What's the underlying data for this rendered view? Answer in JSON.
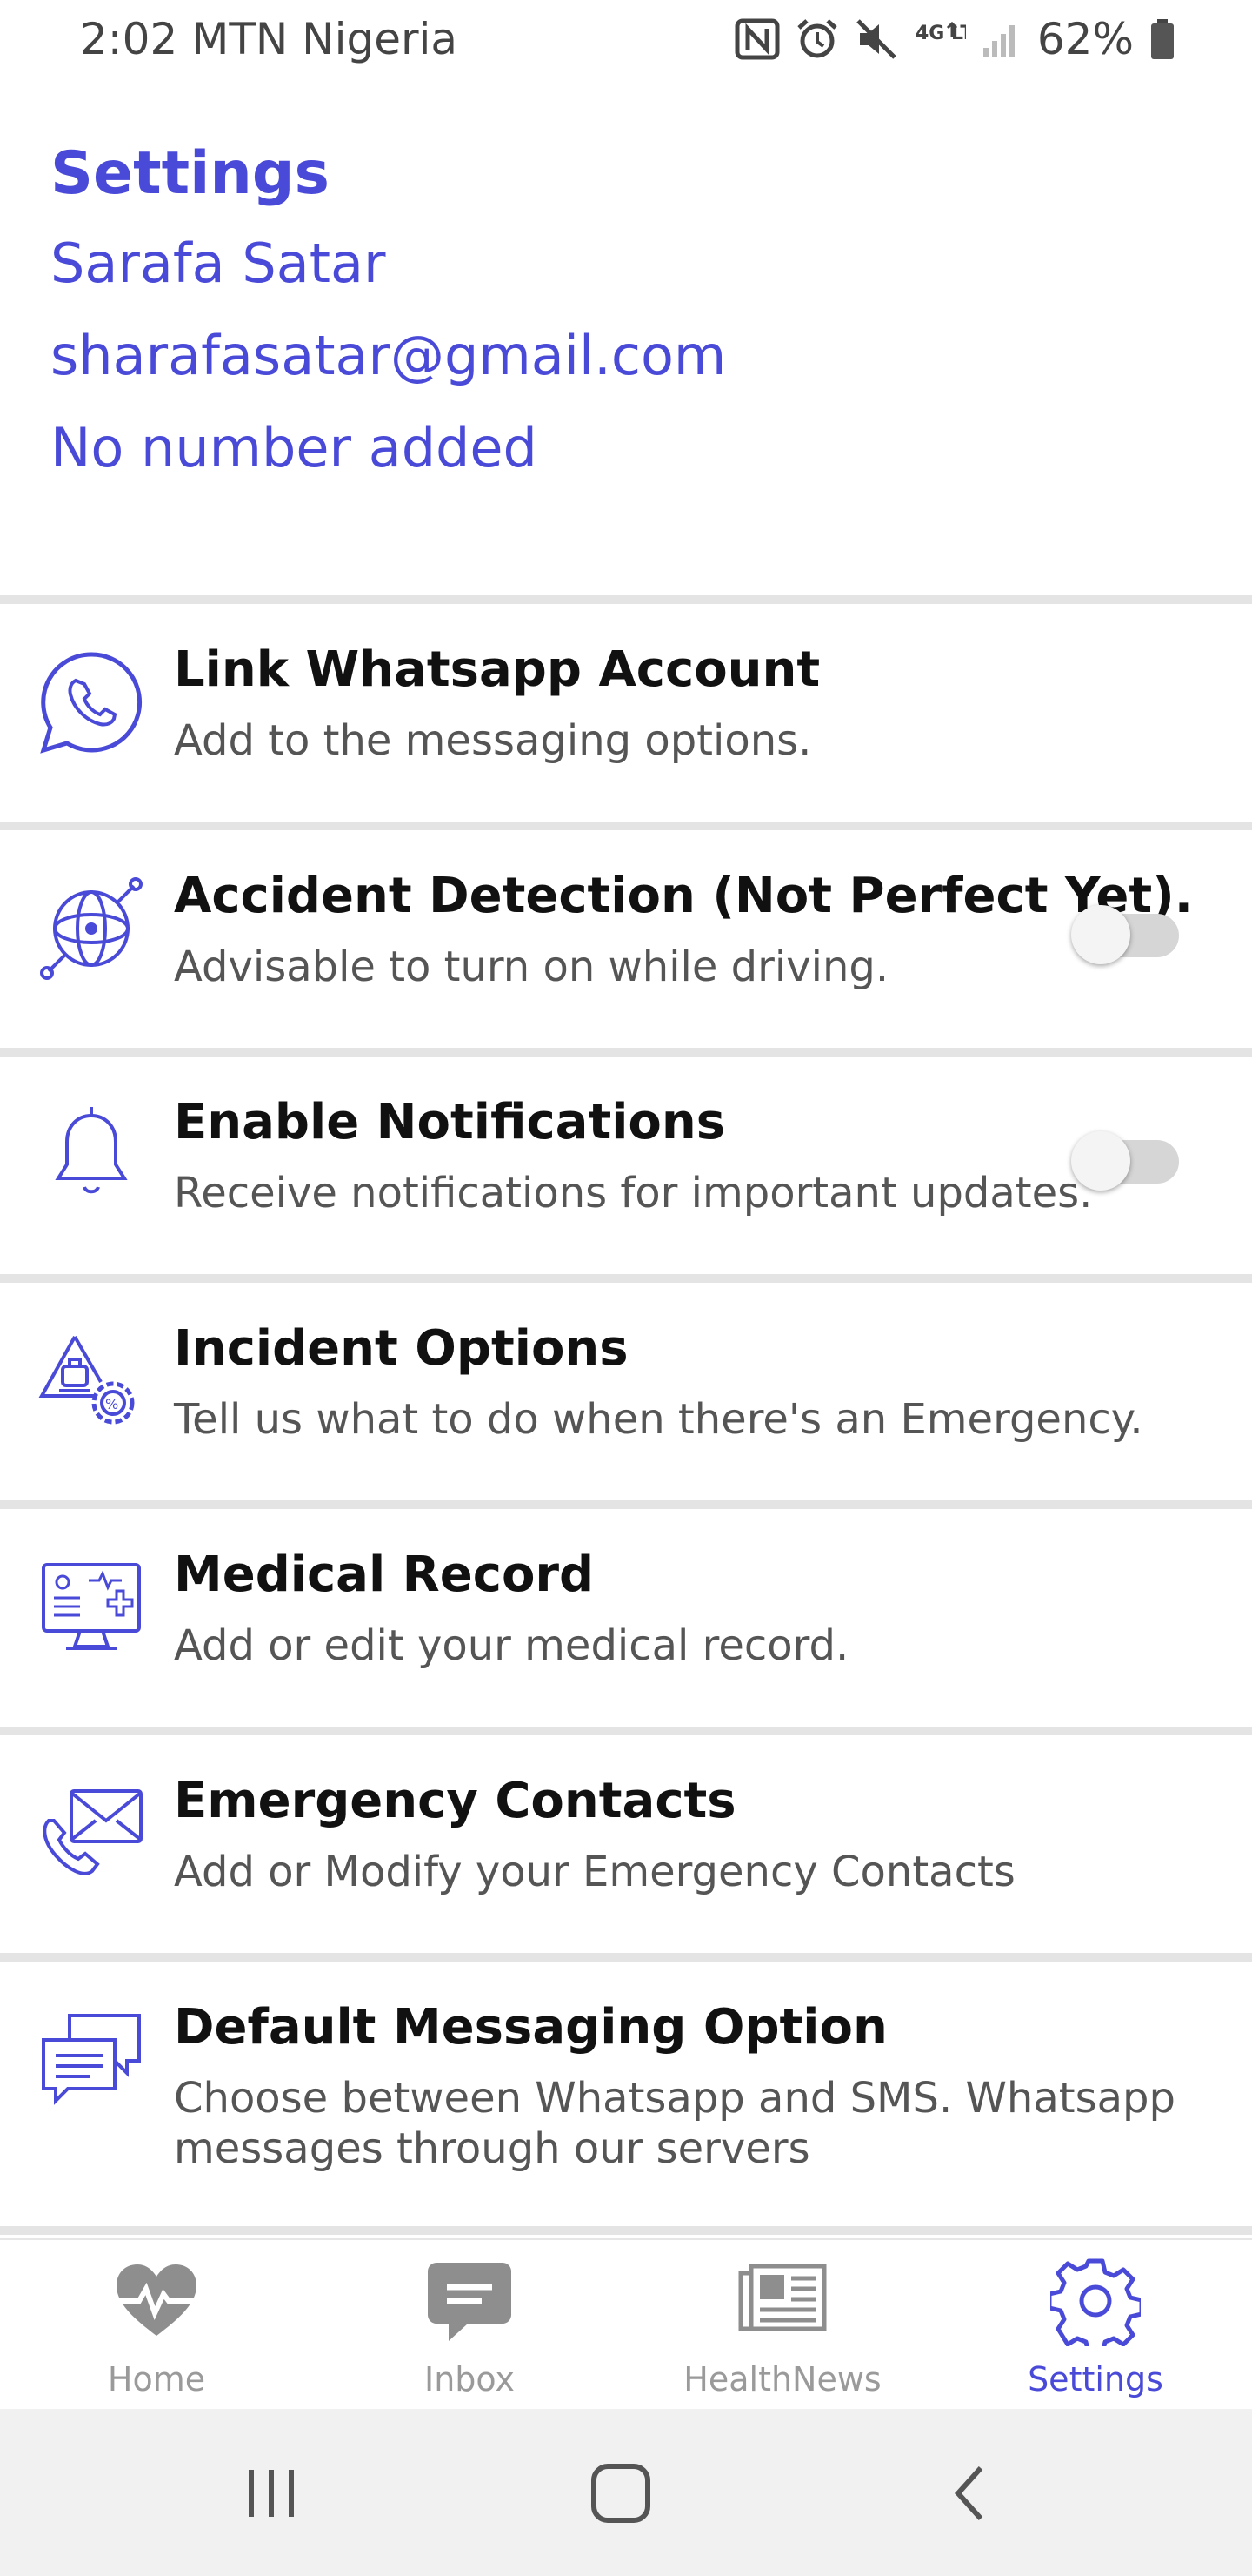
{
  "status_bar": {
    "time": "2:02",
    "carrier": "MTN Nigeria",
    "network": "4G LTE",
    "battery": "62%",
    "icons": [
      "nfc-icon",
      "alarm-icon",
      "mute-icon",
      "network-4g-icon",
      "signal-icon",
      "battery-icon"
    ]
  },
  "header": {
    "title": "Settings",
    "name": "Sarafa Satar",
    "email": "sharafasatar@gmail.com",
    "phone": "No number added"
  },
  "settings": [
    {
      "title": "Link Whatsapp Account",
      "subtitle": "Add to the messaging options.",
      "icon": "whatsapp-icon"
    },
    {
      "title": "Accident Detection (Not Perfect Yet).",
      "subtitle": "Advisable to turn on while driving.",
      "icon": "accident-detection-icon",
      "toggle": false
    },
    {
      "title": "Enable Notifications",
      "subtitle": "Receive notifications for important updates.",
      "icon": "bell-icon",
      "toggle": false
    },
    {
      "title": "Incident Options",
      "subtitle": "Tell us what to do when there's an Emergency.",
      "icon": "incident-options-icon"
    },
    {
      "title": "Medical Record",
      "subtitle": "Add or edit your medical record.",
      "icon": "medical-record-icon"
    },
    {
      "title": "Emergency Contacts",
      "subtitle": "Add or Modify your Emergency Contacts",
      "icon": "emergency-contacts-icon"
    },
    {
      "title": "Default Messaging Option",
      "subtitle": "Choose between Whatsapp and SMS. Whatsapp messages through our servers",
      "icon": "chat-icon"
    }
  ],
  "bottom_nav": {
    "items": [
      {
        "label": "Home",
        "icon": "heart-pulse-icon",
        "active": false
      },
      {
        "label": "Inbox",
        "icon": "message-icon",
        "active": false
      },
      {
        "label": "HealthNews",
        "icon": "newspaper-icon",
        "active": false
      },
      {
        "label": "Settings",
        "icon": "gear-icon",
        "active": true
      }
    ]
  },
  "system_nav": [
    "recent-apps-icon",
    "home-icon",
    "back-icon"
  ],
  "colors": {
    "accent": "#4a4ad8",
    "inactive": "#9a9a9a",
    "divider": "#e4e4e4",
    "toggle_off": "#d6d6d6"
  }
}
